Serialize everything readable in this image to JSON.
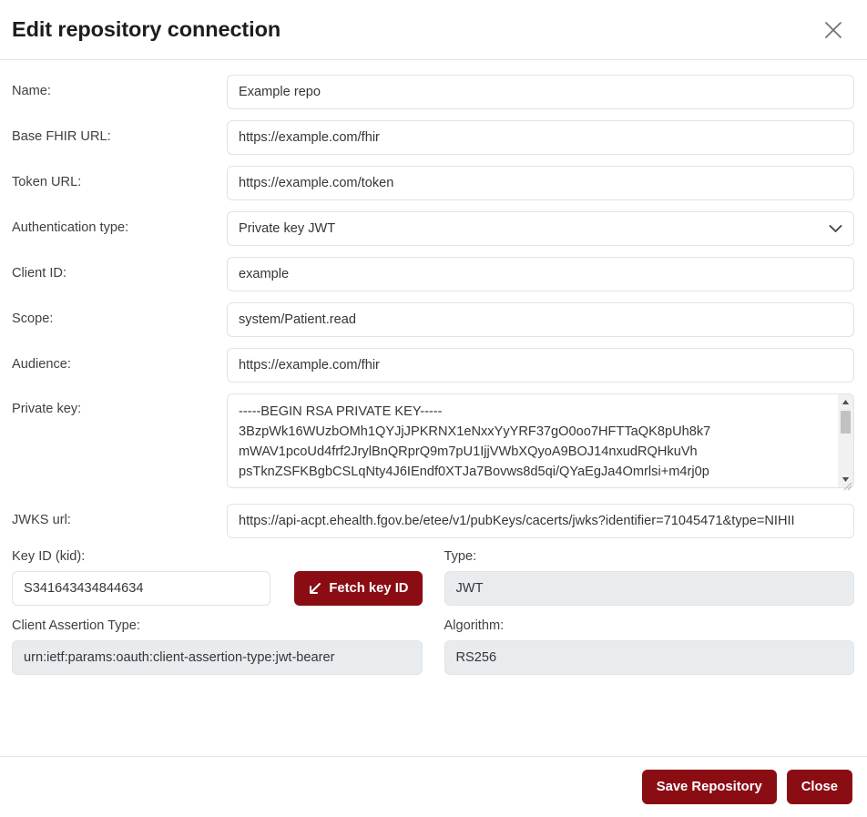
{
  "header": {
    "title": "Edit repository connection",
    "close_icon": "close-icon"
  },
  "fields": {
    "name": {
      "label": "Name:",
      "value": "Example repo"
    },
    "base_fhir_url": {
      "label": "Base FHIR URL:",
      "value": "https://example.com/fhir"
    },
    "token_url": {
      "label": "Token URL:",
      "value": "https://example.com/token"
    },
    "auth_type": {
      "label": "Authentication type:",
      "value": "Private key JWT",
      "options": [
        "Private key JWT"
      ],
      "chevron_icon": "chevron-down-icon"
    },
    "client_id": {
      "label": "Client ID:",
      "value": "example"
    },
    "scope": {
      "label": "Scope:",
      "value": "system/Patient.read"
    },
    "audience": {
      "label": "Audience:",
      "value": "https://example.com/fhir"
    },
    "private_key": {
      "label": "Private key:",
      "value": "-----BEGIN RSA PRIVATE KEY-----\n3BzpWk16WUzbOMh1QYJjJPKRNX1eNxxYyYRF37gO0oo7HFTTaQK8pUh8k7\nmWAV1pcoUd4frf2JrylBnQRprQ9m7pU1IjjVWbXQyoA9BOJ14nxudRQHkuVh\npsTknZSFKBgbCSLqNty4J6IEndf0XTJa7Bovws8d5qi/QYaEgJa4Omrlsi+m4rj0p"
    },
    "jwks_url": {
      "label": "JWKS url:",
      "value": "https://api-acpt.ehealth.fgov.be/etee/v1/pubKeys/cacerts/jwks?identifier=71045471&type=NIHII"
    },
    "key_id": {
      "label": "Key ID (kid):",
      "value": "S341643434844634"
    },
    "type": {
      "label": "Type:",
      "value": "JWT"
    },
    "client_assertion_type": {
      "label": "Client Assertion Type:",
      "value": "urn:ietf:params:oauth:client-assertion-type:jwt-bearer"
    },
    "algorithm": {
      "label": "Algorithm:",
      "value": "RS256"
    }
  },
  "buttons": {
    "fetch_key_id": {
      "label": "Fetch key ID",
      "icon": "arrow-down-left-icon"
    },
    "save_repository": {
      "label": "Save Repository"
    },
    "close": {
      "label": "Close"
    }
  },
  "colors": {
    "danger": "#8b0d14",
    "border": "#e0e2e5",
    "disabled_bg": "#e9ecef",
    "label_text": "#3f4044"
  }
}
